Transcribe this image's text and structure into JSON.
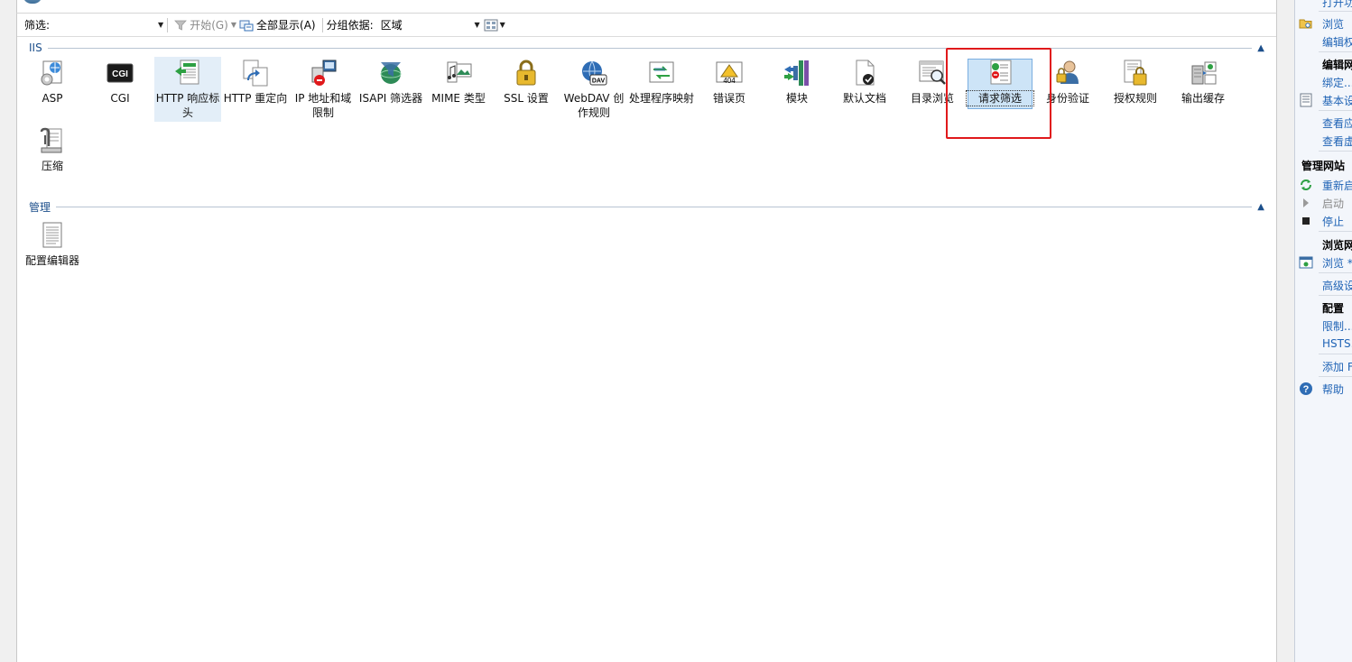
{
  "toolbar": {
    "filter_label": "筛选:",
    "start_label": "开始(G)",
    "show_all_label": "全部显示(A)",
    "group_by_label": "分组依据:",
    "group_by_value": "区域"
  },
  "sections": {
    "iis_title": "IIS",
    "manage_title": "管理"
  },
  "iis_features": [
    {
      "label": "ASP",
      "icon": "asp-icon"
    },
    {
      "label": "CGI",
      "icon": "cgi-icon"
    },
    {
      "label": "HTTP 响应标头",
      "icon": "http-response-headers-icon"
    },
    {
      "label": "HTTP 重定向",
      "icon": "http-redirect-icon"
    },
    {
      "label": "IP 地址和域限制",
      "icon": "ip-domain-restrictions-icon"
    },
    {
      "label": "ISAPI 筛选器",
      "icon": "isapi-filters-icon"
    },
    {
      "label": "MIME 类型",
      "icon": "mime-types-icon"
    },
    {
      "label": "SSL 设置",
      "icon": "ssl-settings-icon"
    },
    {
      "label": "WebDAV 创作规则",
      "icon": "webdav-icon"
    },
    {
      "label": "处理程序映射",
      "icon": "handler-mappings-icon"
    },
    {
      "label": "错误页",
      "icon": "error-pages-icon"
    },
    {
      "label": "模块",
      "icon": "modules-icon"
    },
    {
      "label": "默认文档",
      "icon": "default-document-icon"
    },
    {
      "label": "目录浏览",
      "icon": "directory-browsing-icon"
    },
    {
      "label": "请求筛选",
      "icon": "request-filtering-icon"
    },
    {
      "label": "身份验证",
      "icon": "authentication-icon"
    },
    {
      "label": "授权规则",
      "icon": "authorization-rules-icon"
    },
    {
      "label": "输出缓存",
      "icon": "output-caching-icon"
    },
    {
      "label": "压缩",
      "icon": "compression-icon"
    }
  ],
  "manage_features": [
    {
      "label": "配置编辑器",
      "icon": "configuration-editor-icon"
    }
  ],
  "actions": {
    "top_partial": "打开功",
    "browse": "浏览",
    "edit_perm": "编辑权",
    "edit_site_head": "编辑网",
    "bindings": "绑定...",
    "basic_settings": "基本设",
    "view_app": "查看应",
    "view_vdir": "查看虚",
    "manage_site_head": "管理网站",
    "restart": "重新启",
    "start": "启动",
    "stop": "停止",
    "browse_site_head": "浏览网",
    "browse_star": "浏览 *",
    "advanced": "高级设",
    "config_head": "配置",
    "limits": "限制...",
    "hsts": "HSTS...",
    "add_ftp": "添加 F",
    "help": "帮助"
  }
}
